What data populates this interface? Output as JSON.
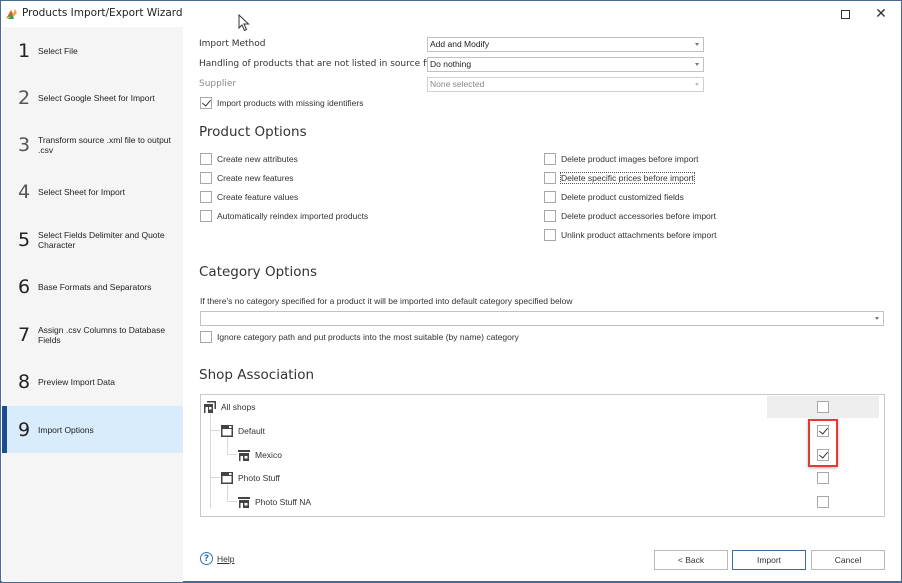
{
  "window": {
    "title": "Products Import/Export Wizard",
    "maximize_icon": "maximize-icon",
    "close_icon": "close-icon"
  },
  "sidebar": {
    "steps": [
      {
        "num": "1",
        "label": "Select File",
        "active": false
      },
      {
        "num": "2",
        "label": "Select Google Sheet for Import",
        "active": false
      },
      {
        "num": "3",
        "label": "Transform source .xml file to output .csv",
        "active": false
      },
      {
        "num": "4",
        "label": "Select Sheet for Import",
        "active": false
      },
      {
        "num": "5",
        "label": "Select Fields Delimiter and Quote Character",
        "active": false
      },
      {
        "num": "6",
        "label": "Base Formats and Separators",
        "active": false
      },
      {
        "num": "7",
        "label": "Assign .csv Columns to Database Fields",
        "active": false
      },
      {
        "num": "8",
        "label": "Preview Import Data",
        "active": false
      },
      {
        "num": "9",
        "label": "Import Options",
        "active": true
      }
    ]
  },
  "import_settings": {
    "import_method_label": "Import Method",
    "import_method_value": "Add and Modify",
    "handling_label": "Handling of products that are not listed in source file",
    "handling_value": "Do nothing",
    "supplier_label": "Supplier",
    "supplier_value": "None selected",
    "missing_identifiers_label": "Import products with missing identifiers",
    "missing_identifiers_checked": true
  },
  "product_options": {
    "title": "Product Options",
    "left": [
      {
        "label": "Create new attributes",
        "checked": false
      },
      {
        "label": "Create new features",
        "checked": false
      },
      {
        "label": "Create feature values",
        "checked": false
      },
      {
        "label": "Automatically reindex imported products",
        "checked": false
      }
    ],
    "right": [
      {
        "label": "Delete product images before import",
        "checked": false
      },
      {
        "label": "Delete specific prices before import",
        "checked": false,
        "focused": true
      },
      {
        "label": "Delete product customized fields",
        "checked": false
      },
      {
        "label": "Delete product accessories before import",
        "checked": false
      },
      {
        "label": "Unlink product attachments before import",
        "checked": false
      }
    ]
  },
  "category_options": {
    "title": "Category Options",
    "description": "If there's no category specified for a product it will be imported into default category specified below",
    "default_category_value": "",
    "ignore_path_label": "Ignore category path and put products into the most suitable (by name) category",
    "ignore_path_checked": false
  },
  "shop_association": {
    "title": "Shop Association",
    "shops": [
      {
        "label": "All shops",
        "level": 0,
        "icon": "shop-group-icon",
        "checked": false
      },
      {
        "label": "Default",
        "level": 1,
        "icon": "shop-window-icon",
        "checked": true
      },
      {
        "label": "Mexico",
        "level": 2,
        "icon": "store-icon",
        "checked": true
      },
      {
        "label": "Photo Stuff",
        "level": 1,
        "icon": "shop-window-icon",
        "checked": false
      },
      {
        "label": "Photo Stuff NA",
        "level": 2,
        "icon": "store-icon",
        "checked": false
      }
    ],
    "highlight_color": "#e53935"
  },
  "footer": {
    "help_label": "Help",
    "back_label": "< Back",
    "import_label": "Import",
    "cancel_label": "Cancel"
  },
  "colors": {
    "accent": "#1e4d8c",
    "active_step_bg": "#d9ecfc",
    "window_border": "#4a6a95",
    "help_blue": "#2f74c8"
  }
}
